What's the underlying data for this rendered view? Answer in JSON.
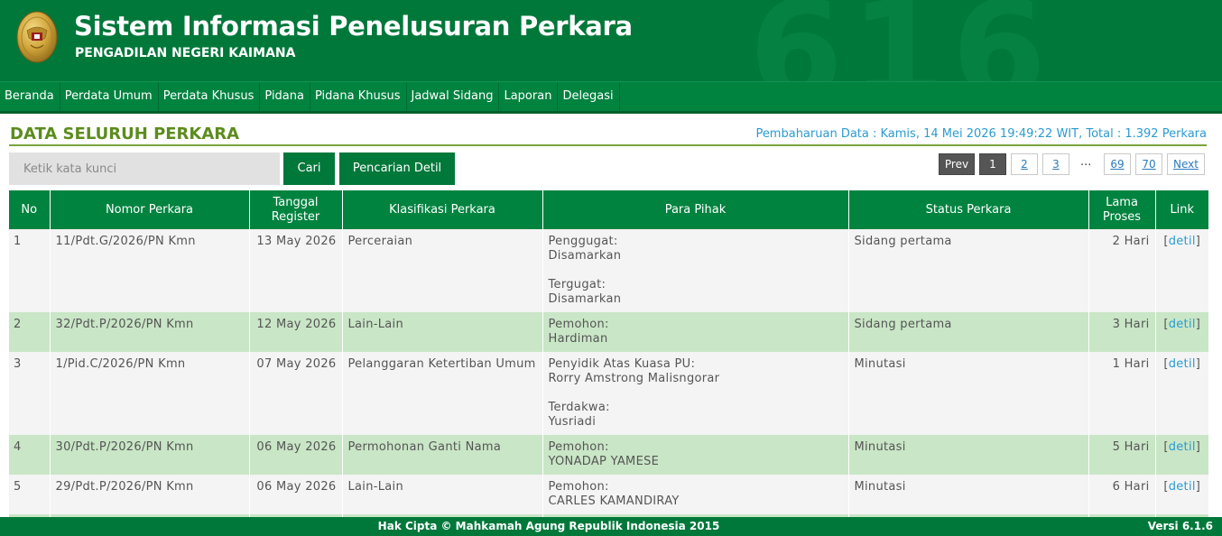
{
  "header": {
    "title": "Sistem Informasi Penelusuran Perkara",
    "subtitle": "PENGADILAN NEGERI KAIMANA",
    "watermark": "616",
    "logo_icon": "mahkamah-agung-emblem-icon"
  },
  "nav": {
    "items": [
      "Beranda",
      "Perdata Umum",
      "Perdata Khusus",
      "Pidana",
      "Pidana Khusus",
      "Jadwal Sidang",
      "Laporan",
      "Delegasi"
    ]
  },
  "content": {
    "title": "DATA SELURUH PERKARA",
    "update_info": "Pembaharuan Data : Kamis, 14 Mei 2026 19:49:22 WIT, Total : 1.392 Perkara"
  },
  "search": {
    "placeholder": "Ketik kata kunci",
    "value": "",
    "cari_label": "Cari",
    "detil_label": "Pencarian Detil"
  },
  "pagination": {
    "prev": "Prev",
    "current": "1",
    "pages": [
      "2",
      "3"
    ],
    "dots": "...",
    "last_pages": [
      "69",
      "70"
    ],
    "next": "Next"
  },
  "table": {
    "headers": {
      "no": "No",
      "nomor": "Nomor Perkara",
      "tanggal_1": "Tanggal",
      "tanggal_2": "Register",
      "klasifikasi": "Klasifikasi Perkara",
      "pihak": "Para Pihak",
      "status": "Status Perkara",
      "lama_1": "Lama",
      "lama_2": "Proses",
      "link": "Link"
    },
    "rows": [
      {
        "no": "1",
        "nomor": "11/Pdt.G/2026/PN Kmn",
        "tanggal": "13 May 2026",
        "klasifikasi": "Perceraian",
        "pihak": [
          "Penggugat:",
          "Disamarkan",
          "",
          "Tergugat:",
          "Disamarkan"
        ],
        "status": "Sidang pertama",
        "lama": "2 Hari",
        "link_pre": "[",
        "link": "detil",
        "link_post": "]"
      },
      {
        "no": "2",
        "nomor": "32/Pdt.P/2026/PN Kmn",
        "tanggal": "12 May 2026",
        "klasifikasi": "Lain-Lain",
        "pihak": [
          "Pemohon:",
          "Hardiman"
        ],
        "status": "Sidang pertama",
        "lama": "3 Hari",
        "link_pre": "[",
        "link": "detil",
        "link_post": "]"
      },
      {
        "no": "3",
        "nomor": "1/Pid.C/2026/PN Kmn",
        "tanggal": "07 May 2026",
        "klasifikasi": "Pelanggaran Ketertiban Umum",
        "pihak": [
          "Penyidik Atas Kuasa PU:",
          "Rorry Amstrong Malisngorar",
          "",
          "Terdakwa:",
          "Yusriadi"
        ],
        "status": "Minutasi",
        "lama": "1 Hari",
        "link_pre": "[",
        "link": "detil",
        "link_post": "]"
      },
      {
        "no": "4",
        "nomor": "30/Pdt.P/2026/PN Kmn",
        "tanggal": "06 May 2026",
        "klasifikasi": "Permohonan Ganti Nama",
        "pihak": [
          "Pemohon:",
          "YONADAP YAMESE"
        ],
        "status": "Minutasi",
        "lama": "5 Hari",
        "link_pre": "[",
        "link": "detil",
        "link_post": "]"
      },
      {
        "no": "5",
        "nomor": "29/Pdt.P/2026/PN Kmn",
        "tanggal": "06 May 2026",
        "klasifikasi": "Lain-Lain",
        "pihak": [
          "Pemohon:",
          "CARLES KAMANDIRAY"
        ],
        "status": "Minutasi",
        "lama": "6 Hari",
        "link_pre": "[",
        "link": "detil",
        "link_post": "]"
      }
    ]
  },
  "footer": {
    "copyright": "Hak Cipta © Mahkamah Agung Republik Indonesia 2015",
    "version": "Versi 6.1.6"
  },
  "colors": {
    "header_green": "#00783a",
    "nav_green": "#00833f",
    "row_even": "#c9e6c6",
    "row_odd": "#f4f4f4",
    "title_green": "#5c8c1e",
    "link_blue": "#2b9bd1"
  }
}
